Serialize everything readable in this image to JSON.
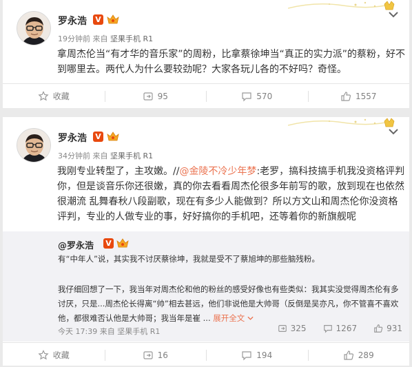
{
  "colors": {
    "accent": "#eb7350",
    "vip": "#e8490f",
    "text": "#333333",
    "muted": "#808080"
  },
  "post1": {
    "username": "罗永浩",
    "verified_glyph": "V",
    "time": "19分钟前",
    "from_label": "来自",
    "source": "坚果手机 R1",
    "text": "拿周杰伦当“有才华的音乐家”的周粉，比拿蔡徐坤当“真正的实力派”的蔡粉，好不到哪里去。两代人为什么要较劲呢？大家各玩儿各的不好吗？奇怪。",
    "actions": {
      "favorite": "收藏",
      "repost": "95",
      "comment": "570",
      "like": "1557"
    }
  },
  "post2": {
    "username": "罗永浩",
    "verified_glyph": "V",
    "time": "34分钟前",
    "from_label": "来自",
    "source": "坚果手机 R1",
    "text_before": "我刚专业转型了，主攻嫩。//",
    "mention": "@金陵不冷少年梦",
    "text_after": ":老罗，搞科技搞手机我没资格评判你，但是谈音乐你还很嫩，真的你去看看周杰伦很多年前写的歌，放到现在也依然很潮流 乱舞春秋八段副歌，现在有多少人能做到？所以方文山和周杰伦你没资格评判，专业的人做专业的事，好好搞你的手机吧，还等着你的新旗舰呢",
    "repost": {
      "author": "@罗永浩",
      "verified_glyph": "V",
      "para1": "有“中年人”说，其实我不讨厌蔡徐坤，我就是受不了蔡旭坤的那些脑残粉。",
      "para2": "我仔细回想了一下，我当年对周杰伦和他的粉丝的感受好像也有些类似：我其实没觉得周杰伦有多讨厌，只是...周杰伦长得离“帅”相去甚远，他们非说他是大帅哥（反倒是吴亦凡，你不管喜不喜欢他，都很难否认他是大帅哥；我当年是崔 ...",
      "expand_label": "展开全文",
      "time": "今天 17:39",
      "from_label": "来自",
      "source": "坚果手机 R1",
      "stats": {
        "repost": "325",
        "comment": "1267",
        "like": "931"
      }
    },
    "actions": {
      "favorite": "收藏",
      "repost": "16",
      "comment": "194",
      "like": "289"
    }
  }
}
